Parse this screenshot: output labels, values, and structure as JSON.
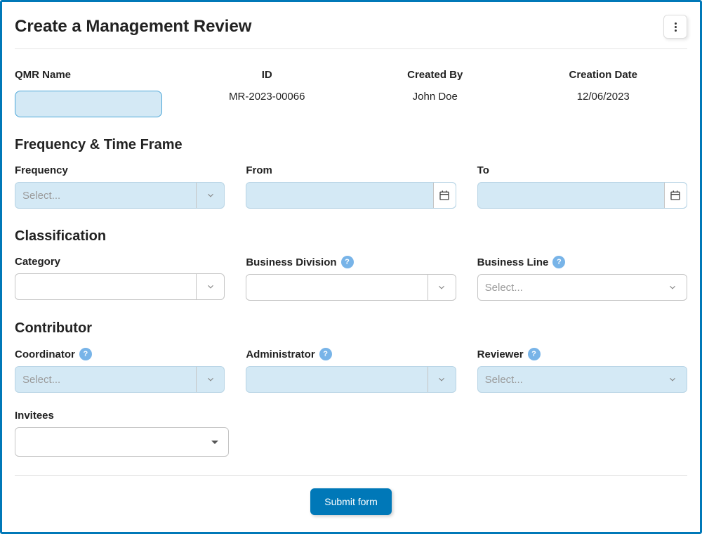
{
  "page": {
    "title": "Create a Management Review"
  },
  "info": {
    "name_label": "QMR Name",
    "id_label": "ID",
    "id_value": "MR-2023-00066",
    "created_by_label": "Created By",
    "created_by_value": "John Doe",
    "creation_date_label": "Creation Date",
    "creation_date_value": "12/06/2023"
  },
  "sections": {
    "frequency": "Frequency & Time Frame",
    "classification": "Classification",
    "contributor": "Contributor"
  },
  "fields": {
    "frequency_label": "Frequency",
    "from_label": "From",
    "to_label": "To",
    "category_label": "Category",
    "business_division_label": "Business Division",
    "business_line_label": "Business Line",
    "coordinator_label": "Coordinator",
    "administrator_label": "Administrator",
    "reviewer_label": "Reviewer",
    "invitees_label": "Invitees"
  },
  "placeholders": {
    "select": "Select..."
  },
  "help_symbol": "?",
  "buttons": {
    "submit": "Submit form"
  }
}
